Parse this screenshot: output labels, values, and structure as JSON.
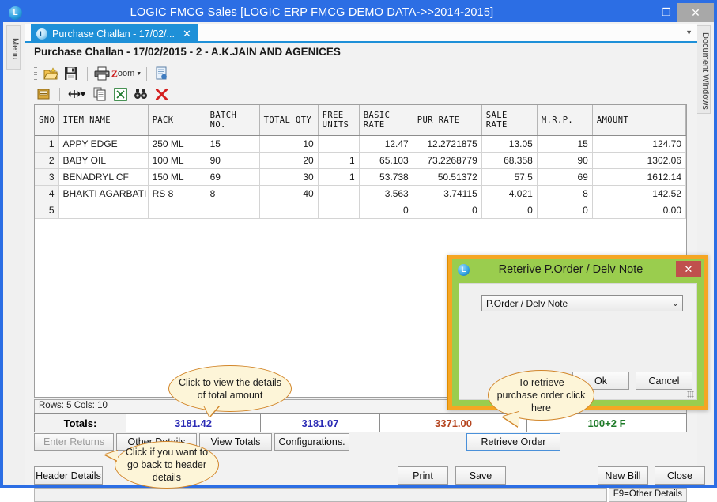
{
  "window": {
    "title": "LOGIC FMCG Sales  [LOGIC ERP FMCG DEMO DATA->>2014-2015]",
    "logo_text": "L",
    "minimize_label": "–",
    "maximize_label": "❐",
    "close_label": "✕"
  },
  "docks": {
    "left_label": "Menu",
    "right_label": "Document Windows"
  },
  "tab": {
    "label": "Purchase Challan - 17/02/...",
    "logo_text": "L",
    "close_label": "✕",
    "overflow_label": "▼"
  },
  "document": {
    "header": "Purchase Challan - 17/02/2015 - 2 - A.K.JAIN AND AGENICES"
  },
  "toolbar1": [
    {
      "name": "new-document-icon",
      "glyph": "📂"
    },
    {
      "name": "save-icon",
      "glyph": "💾"
    },
    {
      "name": "print-icon",
      "glyph": "🖨"
    },
    {
      "name": "zoom-icon",
      "glyph": "Zoom"
    },
    {
      "name": "page-setup-icon",
      "glyph": "📄"
    }
  ],
  "toolbar2": [
    {
      "name": "grid-properties-icon",
      "glyph": "🗔"
    },
    {
      "name": "fit-columns-icon",
      "glyph": "↔"
    },
    {
      "name": "copy-icon",
      "glyph": "❐"
    },
    {
      "name": "export-excel-icon",
      "glyph": "☒"
    },
    {
      "name": "find-icon",
      "glyph": "🔍"
    },
    {
      "name": "delete-icon",
      "glyph": "✕"
    }
  ],
  "grid": {
    "columns": [
      "SNO",
      "ITEM NAME",
      "PACK",
      "BATCH NO.",
      "TOTAL QTY",
      "FREE UNITS",
      "BASIC RATE",
      "PUR RATE",
      "SALE RATE",
      "M.R.P.",
      "AMOUNT"
    ],
    "rows": [
      {
        "sno": "1",
        "item": "APPY EDGE",
        "pack": "250 ML",
        "batch": "15",
        "qty": "10",
        "free": "",
        "basic": "12.47",
        "pur": "12.2721875",
        "sale": "13.05",
        "mrp": "15",
        "amount": "124.70"
      },
      {
        "sno": "2",
        "item": "BABY OIL",
        "pack": "100 ML",
        "batch": "90",
        "qty": "20",
        "free": "1",
        "basic": "65.103",
        "pur": "73.2268779",
        "sale": "68.358",
        "mrp": "90",
        "amount": "1302.06"
      },
      {
        "sno": "3",
        "item": "BENADRYL CF",
        "pack": "150 ML",
        "batch": "69",
        "qty": "30",
        "free": "1",
        "basic": "53.738",
        "pur": "50.51372",
        "sale": "57.5",
        "mrp": "69",
        "amount": "1612.14"
      },
      {
        "sno": "4",
        "item": "BHAKTI AGARBATI",
        "pack": "RS 8",
        "batch": "8",
        "qty": "40",
        "free": "",
        "basic": "3.563",
        "pur": "3.74115",
        "sale": "4.021",
        "mrp": "8",
        "amount": "142.52"
      },
      {
        "sno": "5",
        "item": "",
        "pack": "",
        "batch": "",
        "qty": "",
        "free": "",
        "basic": "0",
        "pur": "0",
        "sale": "0",
        "mrp": "0",
        "amount": "0.00"
      }
    ],
    "status": "Rows: 5  Cols: 10"
  },
  "totals": {
    "label": "Totals:",
    "value1": "3181.42",
    "value1_color": "#2b2bb5",
    "value2": "3181.07",
    "value2_color": "#2b2bb5",
    "value3": "3371.00",
    "value3_color": "#b5451f",
    "value4": "100+2 F",
    "value4_color": "#1e7a28"
  },
  "action_buttons": [
    {
      "name": "enter-returns-button",
      "label": "Enter Returns",
      "state": "disabled"
    },
    {
      "name": "other-details-button",
      "label": "Other Details",
      "state": "normal"
    },
    {
      "name": "view-totals-button",
      "label": "View Totals",
      "state": "normal"
    },
    {
      "name": "configurations-button",
      "label": "Configurations.",
      "state": "normal"
    },
    {
      "name": "retrieve-order-button",
      "label": "Retrieve Order",
      "state": "focused"
    }
  ],
  "footer_buttons": [
    {
      "name": "header-details-button",
      "label": "Header Details"
    },
    {
      "name": "print-button",
      "label": "Print"
    },
    {
      "name": "save-button",
      "label": "Save"
    },
    {
      "name": "new-bill-button",
      "label": "New Bill"
    },
    {
      "name": "close-button",
      "label": "Close"
    }
  ],
  "status_bar": {
    "field_value": "",
    "hint": "F9=Other Details"
  },
  "dialog": {
    "title": "Reterive P.Order / Delv Note",
    "logo_text": "L",
    "close_label": "✕",
    "select_value": "P.Order / Delv Note",
    "select_arrow": "⌄",
    "ok_label": "Ok",
    "cancel_label": "Cancel"
  },
  "callouts": {
    "view_totals": "Click to view the details of total amount",
    "retrieve_order": "To retrieve purchase order click here",
    "header_details": "Click if you want to go back to header details"
  },
  "colors": {
    "title_bar": "#2c6ee4",
    "tab_active": "#1e90d8",
    "dialog_border": "#f5a623",
    "dialog_chrome": "#9acd4e",
    "dialog_close": "#c0504d",
    "callout_bg": "#fdf5d8",
    "callout_border": "#d2862a"
  }
}
